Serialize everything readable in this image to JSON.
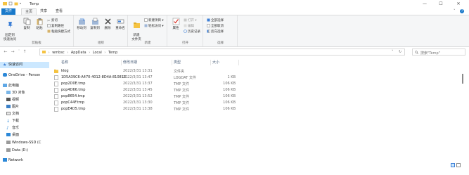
{
  "window": {
    "title": "Temp",
    "minimize": "—",
    "maximize": "☐",
    "close": "✕"
  },
  "tabs": [
    "文件",
    "主页",
    "共享",
    "查看"
  ],
  "ribbon": {
    "clipboard": {
      "pin_quick": "固定到\n快速访问",
      "copy": "复制",
      "paste": "粘贴",
      "cut": "剪切",
      "copy_path": "复制路径",
      "paste_shortcut": "粘贴快捷方式",
      "group": "剪贴板"
    },
    "organize": {
      "move_to": "移动到",
      "copy_to": "复制到",
      "delete": "删除",
      "rename": "重命名",
      "group": "组织"
    },
    "new": {
      "new_folder": "新建\n文件夹",
      "new_item": "新建项目 ▾",
      "easy_access": "轻松访问 ▾",
      "group": "新建"
    },
    "open": {
      "properties": "属性",
      "open": "打开 ▾",
      "edit": "编辑",
      "history": "历史记录",
      "group": "打开"
    },
    "select": {
      "select_all": "全部选择",
      "select_none": "全部取消",
      "invert": "反向选择",
      "group": "选择"
    }
  },
  "address": {
    "crumbs": [
      "wmbsc",
      "AppData",
      "Local",
      "Temp"
    ],
    "search_placeholder": "搜索\"Temp\""
  },
  "navpane": {
    "items": [
      {
        "label": "快速访问",
        "icon": "star-icon",
        "selected": true
      },
      {
        "label": "OneDrive - Person",
        "icon": "cloud-icon"
      },
      {
        "label": "此电脑",
        "icon": "pc-icon"
      },
      {
        "label": "3D 对象",
        "icon": "cube-icon"
      },
      {
        "label": "视频",
        "icon": "video-icon"
      },
      {
        "label": "图片",
        "icon": "picture-icon"
      },
      {
        "label": "文档",
        "icon": "document-icon"
      },
      {
        "label": "下载",
        "icon": "download-icon"
      },
      {
        "label": "音乐",
        "icon": "music-icon"
      },
      {
        "label": "桌面",
        "icon": "desktop-icon"
      },
      {
        "label": "Windows-SSD (C",
        "icon": "drive-icon"
      },
      {
        "label": "Data (D:)",
        "icon": "drive-icon"
      },
      {
        "label": "Network",
        "icon": "network-icon"
      }
    ]
  },
  "columns": {
    "name": "名称",
    "date": "修改日期",
    "type": "类型",
    "size": "大小"
  },
  "files": [
    {
      "name": "klog",
      "date": "2022/3/31 13:31",
      "type": "文件夹",
      "size": "",
      "icon": "folder-icon"
    },
    {
      "name": "1D5A39C6-A470-4012-8D4A-81081C...",
      "date": "2022/3/31 13:47",
      "type": "LOGDAT 文件",
      "size": "1 KB",
      "icon": "file-icon"
    },
    {
      "name": "pop2D0E.tmp",
      "date": "2022/3/31 13:37",
      "type": "TMP 文件",
      "size": "106 KB",
      "icon": "file-icon"
    },
    {
      "name": "pop4D66.tmp",
      "date": "2022/3/31 13:45",
      "type": "TMP 文件",
      "size": "106 KB",
      "icon": "file-icon"
    },
    {
      "name": "pop8654.tmp",
      "date": "2022/3/31 13:52",
      "type": "TMP 文件",
      "size": "106 KB",
      "icon": "file-icon"
    },
    {
      "name": "popC44F.tmp",
      "date": "2022/3/31 13:30",
      "type": "TMP 文件",
      "size": "106 KB",
      "icon": "file-icon"
    },
    {
      "name": "popE4D5.tmp",
      "date": "2022/3/31 13:38",
      "type": "TMP 文件",
      "size": "106 KB",
      "icon": "file-icon"
    }
  ],
  "colors": {
    "file_tab": "#1979ca",
    "selection": "#cce8ff",
    "folder": "#f5c342"
  }
}
